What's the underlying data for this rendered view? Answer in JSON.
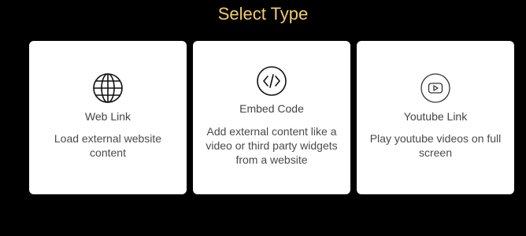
{
  "page": {
    "title": "Select Type",
    "accent_color": "#f3cc6a"
  },
  "cards": [
    {
      "name": "Web Link",
      "description": "Load external website content",
      "icon": "globe-icon"
    },
    {
      "name": "Embed Code",
      "description": "Add external content like a video or third party widgets from a website",
      "icon": "code-icon"
    },
    {
      "name": "Youtube Link",
      "description": "Play youtube videos on full screen",
      "icon": "play-icon"
    }
  ]
}
